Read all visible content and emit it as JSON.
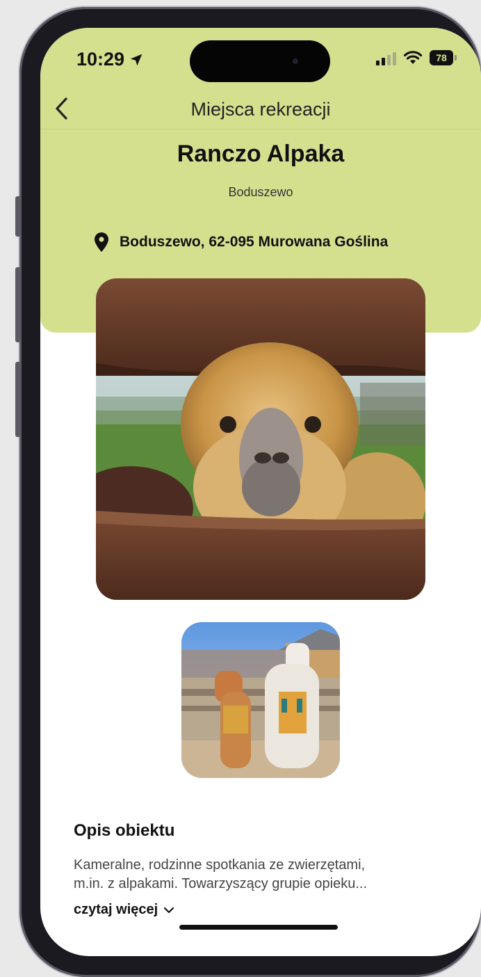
{
  "status_bar": {
    "time": "10:29",
    "battery": "78"
  },
  "nav": {
    "title": "Miejsca rekreacji"
  },
  "place": {
    "name": "Ranczo Alpaka",
    "locality": "Boduszewo",
    "address": "Boduszewo, 62-095 Murowana Goślina"
  },
  "description": {
    "title": "Opis obiektu",
    "line1": "Kameralne, rodzinne spotkania ze zwierzętami,",
    "line2": "m.in. z alpakami. Towarzyszący grupie opieku...",
    "read_more": "czytaj więcej"
  },
  "colors": {
    "header_green": "#d5e08f",
    "text_dark": "#111111"
  },
  "icons": {
    "back": "chevron-left-icon",
    "location": "map-pin-icon",
    "read_more": "chevron-down-icon",
    "wifi": "wifi-icon",
    "signal": "cellular-signal-icon",
    "nav_arrow": "location-arrow-icon"
  }
}
